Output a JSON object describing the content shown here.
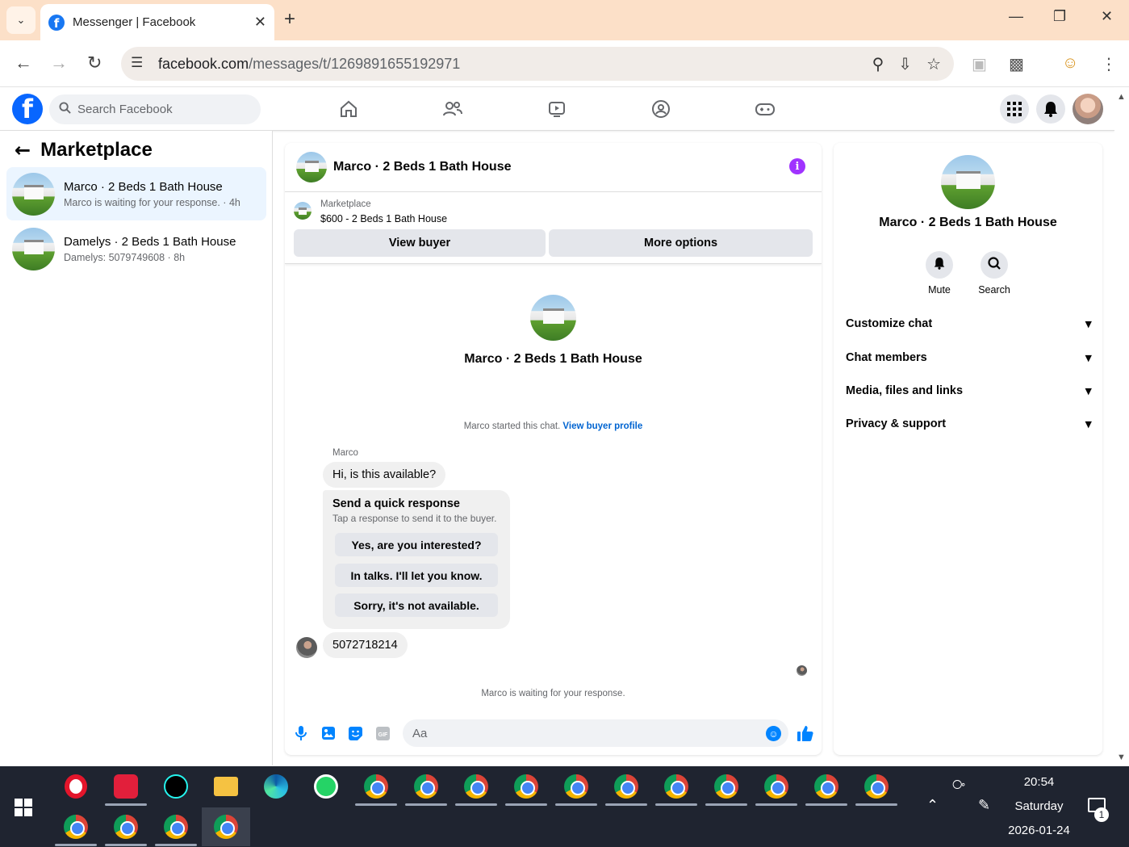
{
  "browser": {
    "tab_title": "Messenger | Facebook",
    "url_host": "facebook.com",
    "url_path": "/messages/t/1269891655192971"
  },
  "fb": {
    "search_placeholder": "Search Facebook"
  },
  "sidebar": {
    "title": "Marketplace",
    "conversations": [
      {
        "name": "Marco · 2 Beds 1 Bath House",
        "preview": "Marco is waiting for your response. · 4h"
      },
      {
        "name": "Damelys · 2 Beds 1 Bath House",
        "preview": "Damelys: 5079749608 · 8h"
      }
    ]
  },
  "chat": {
    "title": "Marco · 2 Beds 1 Bath House",
    "listing_label": "Marketplace",
    "listing_price": "$600 - 2 Beds 1 Bath House",
    "view_buyer": "View buyer",
    "more_options": "More options",
    "intro_name": "Marco · 2 Beds 1 Bath House",
    "started_text": "Marco started this chat. ",
    "view_buyer_profile": "View buyer profile",
    "sender": "Marco",
    "message1": "Hi, is this available?",
    "quick_title": "Send a quick response",
    "quick_sub": "Tap a response to send it to the buyer.",
    "quick_responses": [
      "Yes, are you interested?",
      "In talks. I'll let you know.",
      "Sorry, it's not available."
    ],
    "message2": "5072718214",
    "waiting": "Marco is waiting for your response.",
    "input_placeholder": "Aa",
    "gif_label": "GIF"
  },
  "details": {
    "name": "Marco · 2 Beds 1 Bath House",
    "mute": "Mute",
    "search": "Search",
    "sections": [
      "Customize chat",
      "Chat members",
      "Media, files and links",
      "Privacy & support"
    ]
  },
  "taskbar": {
    "time": "20:54",
    "day": "Saturday",
    "date": "2026-01-24",
    "notifications": "1"
  }
}
